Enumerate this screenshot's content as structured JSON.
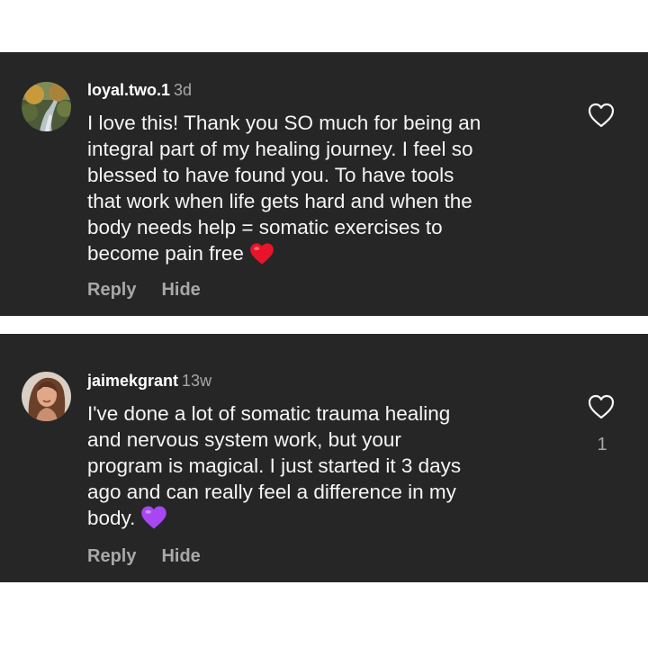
{
  "comments": [
    {
      "username": "loyal.two.1",
      "time": "3d",
      "lines": [
        "I love this!  Thank you SO much for being an",
        "integral part of my healing journey. I feel so",
        "blessed to have found you. To have tools",
        "that work when life gets hard and when the",
        "body needs help = somatic exercises to",
        "become pain free"
      ],
      "emoji": "red-heart",
      "reply_label": "Reply",
      "hide_label": "Hide",
      "like_count": ""
    },
    {
      "username": "jaimekgrant",
      "time": "13w",
      "lines": [
        "I've done a lot of somatic trauma healing",
        "and nervous system work, but your",
        "program is magical. I just started it 3 days",
        "ago and can really feel a difference in my",
        "body."
      ],
      "emoji": "purple-heart",
      "reply_label": "Reply",
      "hide_label": "Hide",
      "like_count": "1"
    }
  ],
  "colors": {
    "card_background": "#262626",
    "text": "#f5f5f5",
    "secondary_text": "#a8a8a8",
    "red_heart": "#e8142b",
    "purple_heart": "#a746f2"
  }
}
